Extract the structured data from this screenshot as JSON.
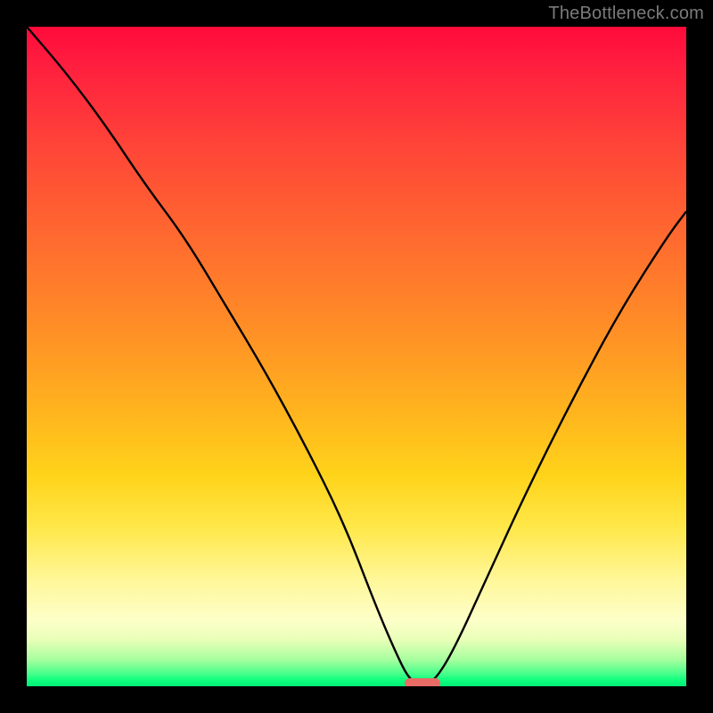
{
  "watermark": {
    "text": "TheBottleneck.com"
  },
  "chart_data": {
    "type": "line",
    "title": "",
    "xlabel": "",
    "ylabel": "",
    "xlim": [
      0,
      100
    ],
    "ylim": [
      0,
      100
    ],
    "grid": false,
    "legend": false,
    "series": [
      {
        "name": "bottleneck-curve",
        "x": [
          0,
          6,
          12,
          18,
          24,
          30,
          36,
          42,
          48,
          53,
          56,
          58,
          60,
          62,
          65,
          70,
          76,
          83,
          90,
          97,
          100
        ],
        "values": [
          100,
          93,
          85,
          76,
          68,
          58,
          48,
          37,
          25,
          12,
          5,
          1,
          0,
          1,
          6,
          17,
          30,
          44,
          57,
          68,
          72
        ]
      }
    ],
    "minimum_marker": {
      "x": 60,
      "y": 0,
      "color": "#e96b65"
    },
    "background_gradient": {
      "orientation": "vertical",
      "stops": [
        {
          "pos": 0.0,
          "color": "#ff0a3a"
        },
        {
          "pos": 0.32,
          "color": "#ff6a2f"
        },
        {
          "pos": 0.68,
          "color": "#ffd31a"
        },
        {
          "pos": 0.9,
          "color": "#fdffc9"
        },
        {
          "pos": 1.0,
          "color": "#00ef76"
        }
      ]
    }
  }
}
